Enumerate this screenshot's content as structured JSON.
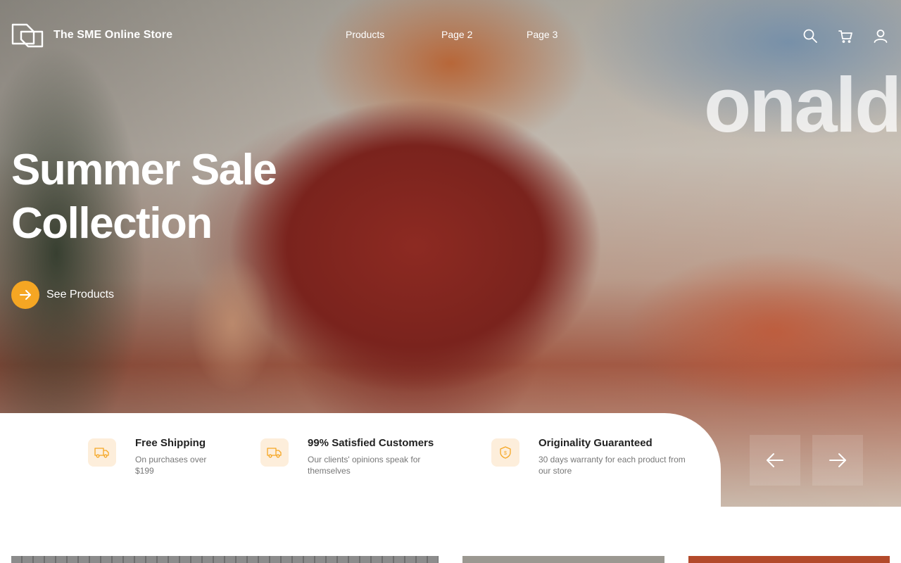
{
  "brand": {
    "name": "The SME Online Store",
    "logo_icon": "store-logo-icon"
  },
  "nav": {
    "items": [
      {
        "label": "Products"
      },
      {
        "label": "Page 2"
      },
      {
        "label": "Page 3"
      }
    ]
  },
  "header_icons": [
    "search-icon",
    "cart-icon",
    "user-icon"
  ],
  "hero": {
    "title_line1": "Summer Sale",
    "title_line2": "Collection",
    "cta_label": "See Products",
    "sign_text": "onald"
  },
  "features": [
    {
      "title": "Free Shipping",
      "desc": "On purchases over $199",
      "icon": "truck-icon"
    },
    {
      "title": "99% Satisfied Customers",
      "desc": "Our clients' opinions speak for themselves",
      "icon": "truck-icon"
    },
    {
      "title": "Originality Guaranteed",
      "desc": "30 days warranty for each product from our store",
      "icon": "shield-icon"
    }
  ],
  "colors": {
    "accent": "#f5a623",
    "icon_bg": "#fdeedb",
    "text_dark": "#222222",
    "text_muted": "#777777"
  }
}
